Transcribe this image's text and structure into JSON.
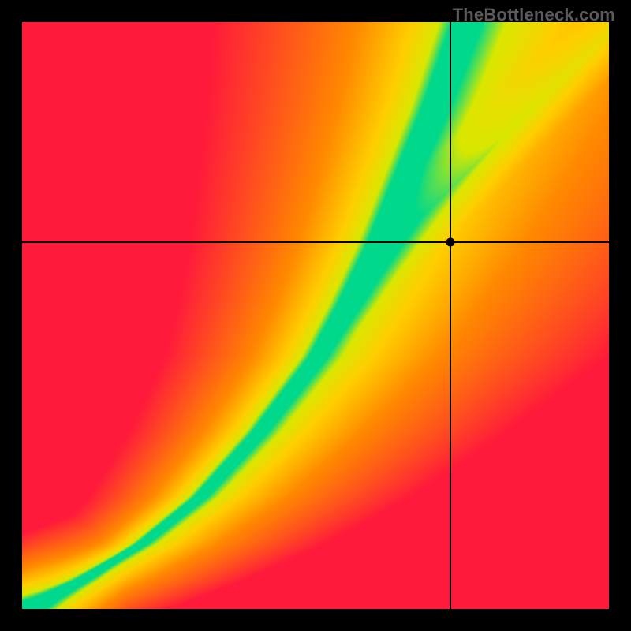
{
  "watermark": "TheBottleneck.com",
  "chart_data": {
    "type": "heatmap",
    "title": "",
    "xlabel": "",
    "ylabel": "",
    "xlim": [
      0,
      1
    ],
    "ylim": [
      0,
      1
    ],
    "marker": {
      "x": 0.73,
      "y": 0.625
    },
    "green_curve": {
      "description": "center of the optimal (green) band; bottleneck compatibility ridge",
      "control_points": [
        {
          "x": 0.0,
          "y": 0.0
        },
        {
          "x": 0.1,
          "y": 0.05
        },
        {
          "x": 0.2,
          "y": 0.11
        },
        {
          "x": 0.3,
          "y": 0.19
        },
        {
          "x": 0.4,
          "y": 0.3
        },
        {
          "x": 0.5,
          "y": 0.43
        },
        {
          "x": 0.55,
          "y": 0.52
        },
        {
          "x": 0.6,
          "y": 0.62
        },
        {
          "x": 0.65,
          "y": 0.74
        },
        {
          "x": 0.7,
          "y": 0.86
        },
        {
          "x": 0.75,
          "y": 1.0
        }
      ],
      "band_halfwidth_x": 0.045
    },
    "colors": {
      "best": "#00d98b",
      "good": "#d9e800",
      "ok": "#ffcf00",
      "warm": "#ff8a00",
      "bad": "#ff1a3c"
    }
  }
}
